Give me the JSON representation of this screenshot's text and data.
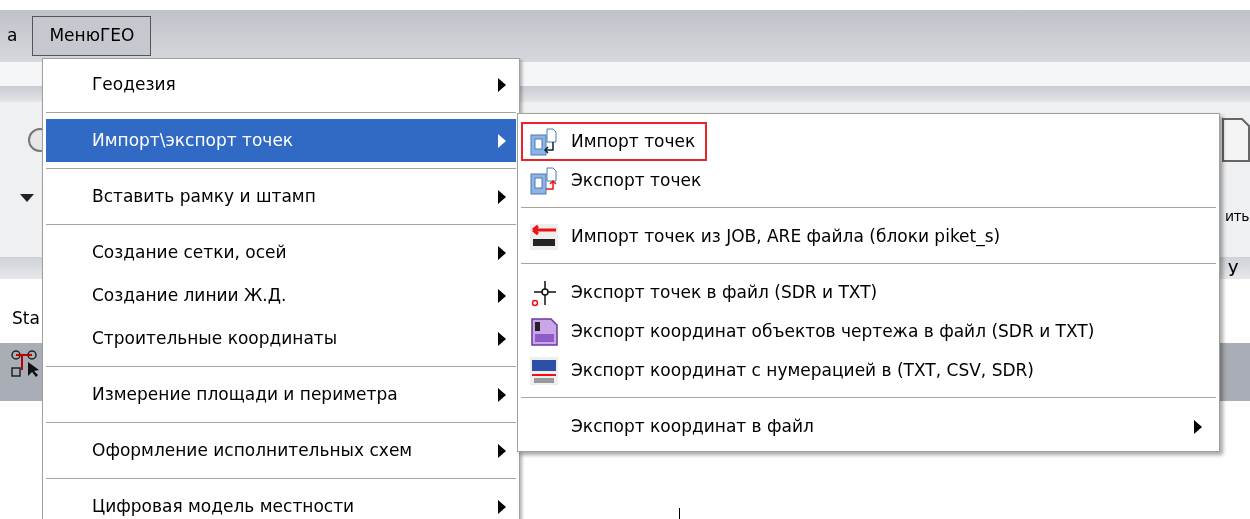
{
  "menu_bar": {
    "items": [
      {
        "label": "а",
        "selected": false
      },
      {
        "label": "МенюГЕО",
        "selected": true
      }
    ]
  },
  "left_panel_label": "Sta",
  "right_button_label": "ить",
  "right_column_label": "У",
  "menu": {
    "items": [
      {
        "kind": "item",
        "label": "Геодезия",
        "has_submenu": true,
        "selected": false
      },
      {
        "kind": "separator"
      },
      {
        "kind": "item",
        "label": "Импорт\\экспорт точек",
        "has_submenu": true,
        "selected": true
      },
      {
        "kind": "separator"
      },
      {
        "kind": "item",
        "label": "Вставить рамку и штамп",
        "has_submenu": true,
        "selected": false
      },
      {
        "kind": "separator"
      },
      {
        "kind": "item",
        "label": "Создание сетки, осей",
        "has_submenu": true,
        "selected": false
      },
      {
        "kind": "item",
        "label": "Создание линии Ж.Д.",
        "has_submenu": true,
        "selected": false
      },
      {
        "kind": "item",
        "label": "Строительные координаты",
        "has_submenu": true,
        "selected": false
      },
      {
        "kind": "separator"
      },
      {
        "kind": "item",
        "label": "Измерение площади и периметра",
        "has_submenu": true,
        "selected": false
      },
      {
        "kind": "separator"
      },
      {
        "kind": "item",
        "label": "Оформление исполнительных схем",
        "has_submenu": true,
        "selected": false
      },
      {
        "kind": "separator"
      },
      {
        "kind": "item",
        "label": "Цифровая модель местности",
        "has_submenu": true,
        "selected": false
      }
    ]
  },
  "submenu": {
    "items": [
      {
        "kind": "item",
        "label": "Импорт точек",
        "highlighted": true,
        "has_submenu": false,
        "selected": false
      },
      {
        "kind": "item",
        "label": "Экспорт точек",
        "highlighted": false,
        "has_submenu": false,
        "selected": false
      },
      {
        "kind": "separator"
      },
      {
        "kind": "item",
        "label": "Импорт точек из JOB, ARE файла (блоки piket_s)",
        "highlighted": false,
        "has_submenu": false,
        "selected": false
      },
      {
        "kind": "separator"
      },
      {
        "kind": "item",
        "label": "Экспорт точек в файл (SDR и TXT)",
        "highlighted": false,
        "has_submenu": false,
        "selected": false
      },
      {
        "kind": "item",
        "label": "Экспорт координат объектов чертежа в файл (SDR и TXT)",
        "highlighted": false,
        "has_submenu": false,
        "selected": false
      },
      {
        "kind": "item",
        "label": "Экспорт координат с нумерацией в (TXT, CSV, SDR)",
        "highlighted": false,
        "has_submenu": false,
        "selected": false
      },
      {
        "kind": "separator"
      },
      {
        "kind": "item",
        "label": "Экспорт координат в файл",
        "highlighted": false,
        "has_submenu": true,
        "selected": false
      }
    ]
  }
}
